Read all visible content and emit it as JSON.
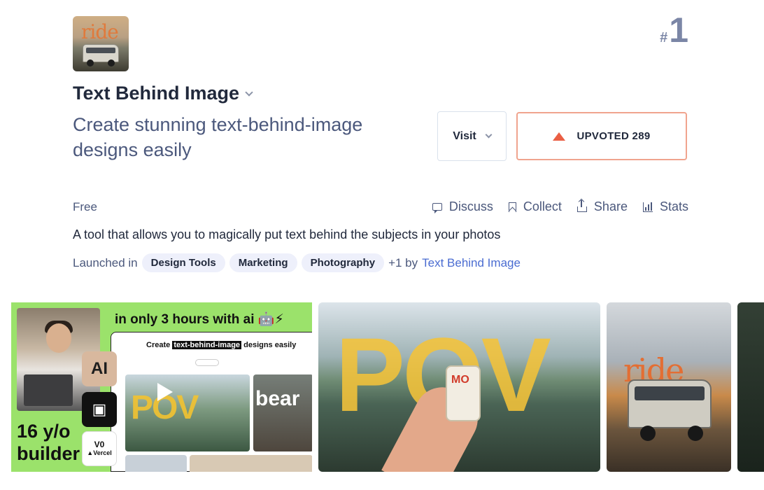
{
  "product": {
    "name": "Text Behind Image",
    "tagline": "Create stunning text-behind-image designs easily",
    "rank_hash": "#",
    "rank": "1",
    "logo_word": "ride",
    "pricing": "Free",
    "description": "A tool that allows you to magically put text behind the subjects in your photos"
  },
  "buttons": {
    "visit": "Visit",
    "upvote": "UPVOTED 289"
  },
  "actions": [
    {
      "label": "Discuss",
      "icon": "comment-icon"
    },
    {
      "label": "Collect",
      "icon": "bookmark-icon"
    },
    {
      "label": "Share",
      "icon": "share-icon"
    },
    {
      "label": "Stats",
      "icon": "bar-chart-icon"
    }
  ],
  "launched": {
    "prefix": "Launched in",
    "tags": [
      "Design Tools",
      "Marketing",
      "Photography"
    ],
    "more": "+1 by",
    "maker": "Text Behind Image"
  },
  "gallery": {
    "shot1": {
      "banner": "in only 3 hours with ai 🤖⚡",
      "card_title_pre": "Create",
      "card_title_highlight": "text-behind-image",
      "card_title_post": "designs easily",
      "pov": "POV",
      "bear": "bear",
      "logo_a": "AI",
      "logo_b": "▣",
      "logo_c_top": "V0",
      "logo_c_bottom": "▲Vercel",
      "big_line1": "16 y/o",
      "big_line2": "builder"
    },
    "shot2": {
      "word": "POV",
      "can_label": "MO"
    },
    "shot3": {
      "word": "ride"
    }
  },
  "colors": {
    "upvote_accent": "#ea5f44",
    "upvote_border": "#f0a48e",
    "tag_bg": "#eef0fb",
    "maker_link": "#4a6cd1",
    "rank": "#7b86a6"
  }
}
